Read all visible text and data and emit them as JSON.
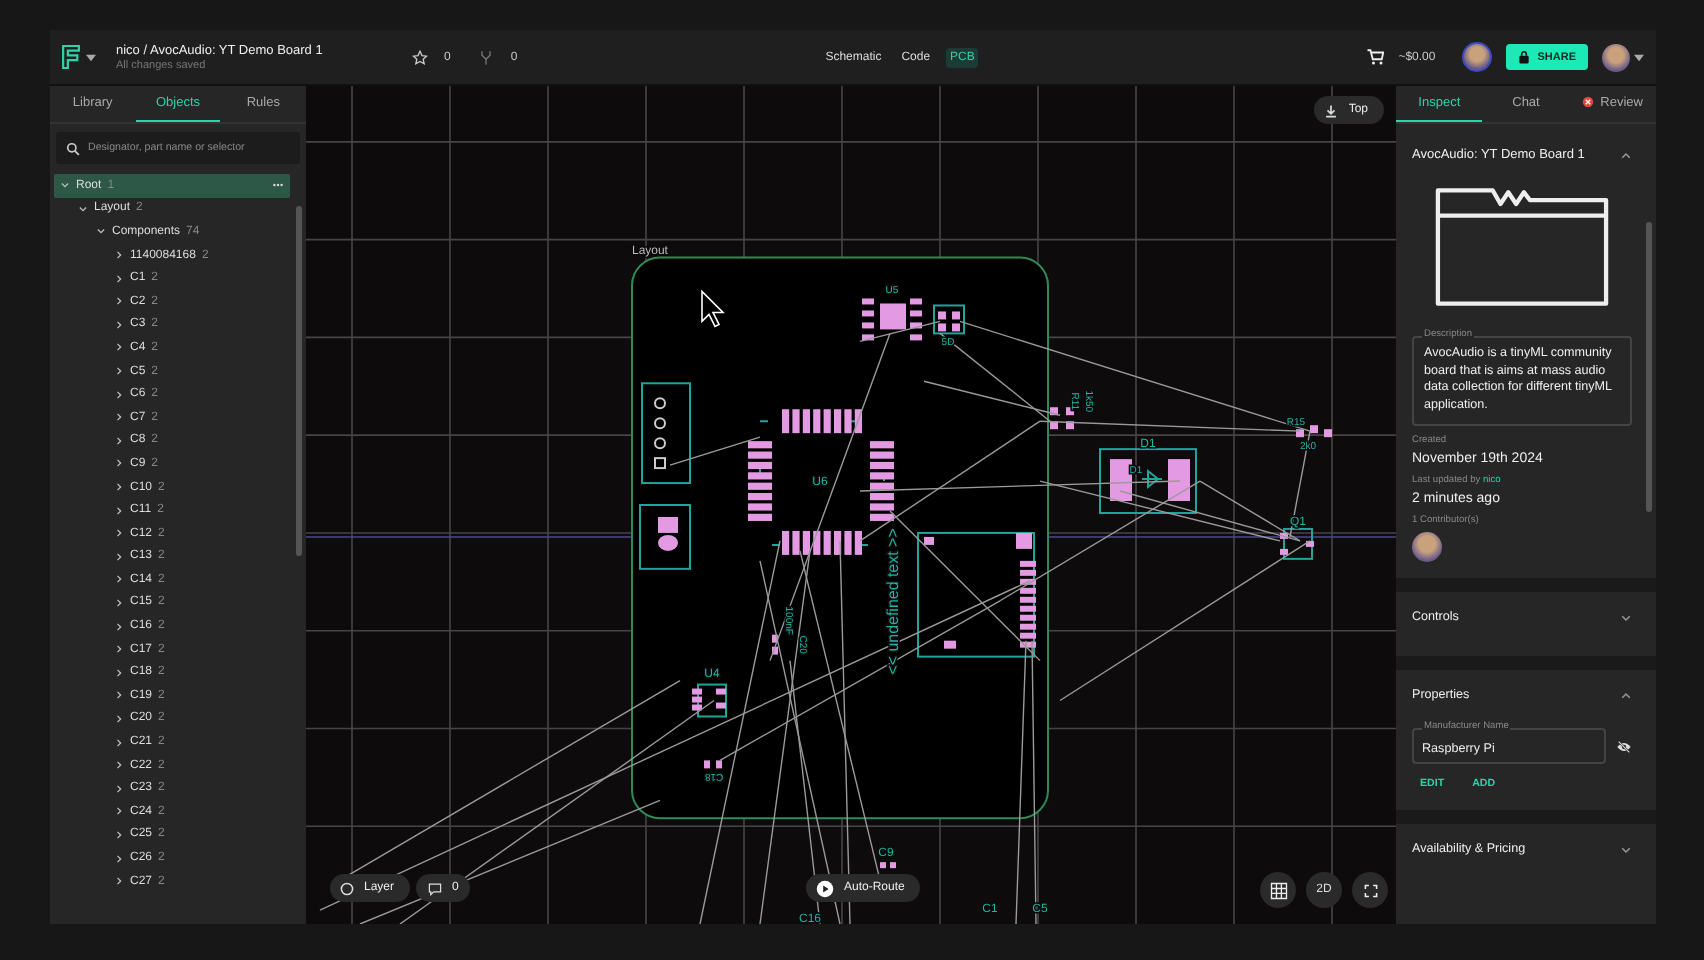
{
  "top_bar": {
    "breadcrumb": "nico / AvocAudio: YT Demo Board 1",
    "save_status": "All changes saved",
    "stars": "0",
    "forks": "0",
    "view_tabs": [
      {
        "label": "Schematic",
        "selected": false
      },
      {
        "label": "Code",
        "selected": false
      },
      {
        "label": "PCB",
        "selected": true
      }
    ],
    "price": "~$0.00",
    "share_button": "SHARE"
  },
  "left_panel": {
    "tabs": [
      {
        "label": "Library",
        "selected": false
      },
      {
        "label": "Objects",
        "selected": true
      },
      {
        "label": "Rules",
        "selected": false
      }
    ],
    "search": {
      "placeholder": "Designator, part name or selector"
    },
    "tree": [
      {
        "label": "Root",
        "count": "1",
        "expanded": true,
        "selected": true,
        "children": [
          {
            "label": "Layout",
            "count": "2",
            "expanded": true,
            "selected": false,
            "children": [
              {
                "label": "Components",
                "count": "74",
                "expanded": true,
                "selected": false,
                "children": [
                  {
                    "label": "1140084168",
                    "count": "2",
                    "expanded": false,
                    "selected": false
                  },
                  {
                    "label": "C1",
                    "count": "2",
                    "expanded": false,
                    "selected": false
                  },
                  {
                    "label": "C2",
                    "count": "2",
                    "expanded": false,
                    "selected": false
                  },
                  {
                    "label": "C3",
                    "count": "2",
                    "expanded": false,
                    "selected": false
                  },
                  {
                    "label": "C4",
                    "count": "2",
                    "expanded": false,
                    "selected": false
                  },
                  {
                    "label": "C5",
                    "count": "2",
                    "expanded": false,
                    "selected": false
                  },
                  {
                    "label": "C6",
                    "count": "2",
                    "expanded": false,
                    "selected": false
                  },
                  {
                    "label": "C7",
                    "count": "2",
                    "expanded": false,
                    "selected": false
                  },
                  {
                    "label": "C8",
                    "count": "2",
                    "expanded": false,
                    "selected": false
                  },
                  {
                    "label": "C9",
                    "count": "2",
                    "expanded": false,
                    "selected": false
                  },
                  {
                    "label": "C10",
                    "count": "2",
                    "expanded": false,
                    "selected": false
                  },
                  {
                    "label": "C11",
                    "count": "2",
                    "expanded": false,
                    "selected": false
                  },
                  {
                    "label": "C12",
                    "count": "2",
                    "expanded": false,
                    "selected": false
                  },
                  {
                    "label": "C13",
                    "count": "2",
                    "expanded": false,
                    "selected": false
                  },
                  {
                    "label": "C14",
                    "count": "2",
                    "expanded": false,
                    "selected": false
                  },
                  {
                    "label": "C15",
                    "count": "2",
                    "expanded": false,
                    "selected": false
                  },
                  {
                    "label": "C16",
                    "count": "2",
                    "expanded": false,
                    "selected": false
                  },
                  {
                    "label": "C17",
                    "count": "2",
                    "expanded": false,
                    "selected": false
                  },
                  {
                    "label": "C18",
                    "count": "2",
                    "expanded": false,
                    "selected": false
                  },
                  {
                    "label": "C19",
                    "count": "2",
                    "expanded": false,
                    "selected": false
                  },
                  {
                    "label": "C20",
                    "count": "2",
                    "expanded": false,
                    "selected": false
                  },
                  {
                    "label": "C21",
                    "count": "2",
                    "expanded": false,
                    "selected": false
                  },
                  {
                    "label": "C22",
                    "count": "2",
                    "expanded": false,
                    "selected": false
                  },
                  {
                    "label": "C23",
                    "count": "2",
                    "expanded": false,
                    "selected": false
                  },
                  {
                    "label": "C24",
                    "count": "2",
                    "expanded": false,
                    "selected": false
                  },
                  {
                    "label": "C25",
                    "count": "2",
                    "expanded": false,
                    "selected": false
                  },
                  {
                    "label": "C26",
                    "count": "2",
                    "expanded": false,
                    "selected": false
                  },
                  {
                    "label": "C27",
                    "count": "2",
                    "expanded": false,
                    "selected": false
                  }
                ]
              }
            ]
          }
        ]
      }
    ]
  },
  "canvas": {
    "view_button": "Top",
    "labels": [
      "Layout",
      "U5",
      "5D",
      "U6",
      "D1",
      "D1",
      "R11",
      "1k50",
      "R15",
      "2k0",
      "Q1",
      "U4",
      "C18",
      "C20",
      "100nF",
      "C9",
      "C1",
      "C5",
      "C16",
      "<< undefined text >>"
    ],
    "layer_button": "Layer",
    "comments": "0",
    "auto_route_button": "Auto-Route",
    "view_mode_button": "2D"
  },
  "right_panel": {
    "tabs": [
      {
        "label": "Inspect",
        "selected": true
      },
      {
        "label": "Chat",
        "selected": false
      },
      {
        "label": "Review",
        "selected": false
      }
    ],
    "board": {
      "title": "AvocAudio: YT Demo Board 1",
      "expanded": true,
      "description_label": "Description",
      "description": "AvocAudio is a tinyML community board that is aims at mass audio data collection for different tinyML application.",
      "created_label": "Created",
      "created": "November 19th 2024",
      "updated_label": "Last updated by",
      "updated_by": "nico",
      "updated": "2 minutes ago",
      "contributors": "1 Contributor(s)"
    },
    "sections": [
      {
        "title": "Controls",
        "expanded": false
      },
      {
        "title": "Properties",
        "expanded": true,
        "fields": [
          {
            "label": "Manufacturer Name",
            "value": "Raspberry Pi"
          }
        ],
        "actions": [
          "EDIT",
          "ADD"
        ]
      },
      {
        "title": "Availability & Pricing",
        "expanded": false
      }
    ]
  }
}
